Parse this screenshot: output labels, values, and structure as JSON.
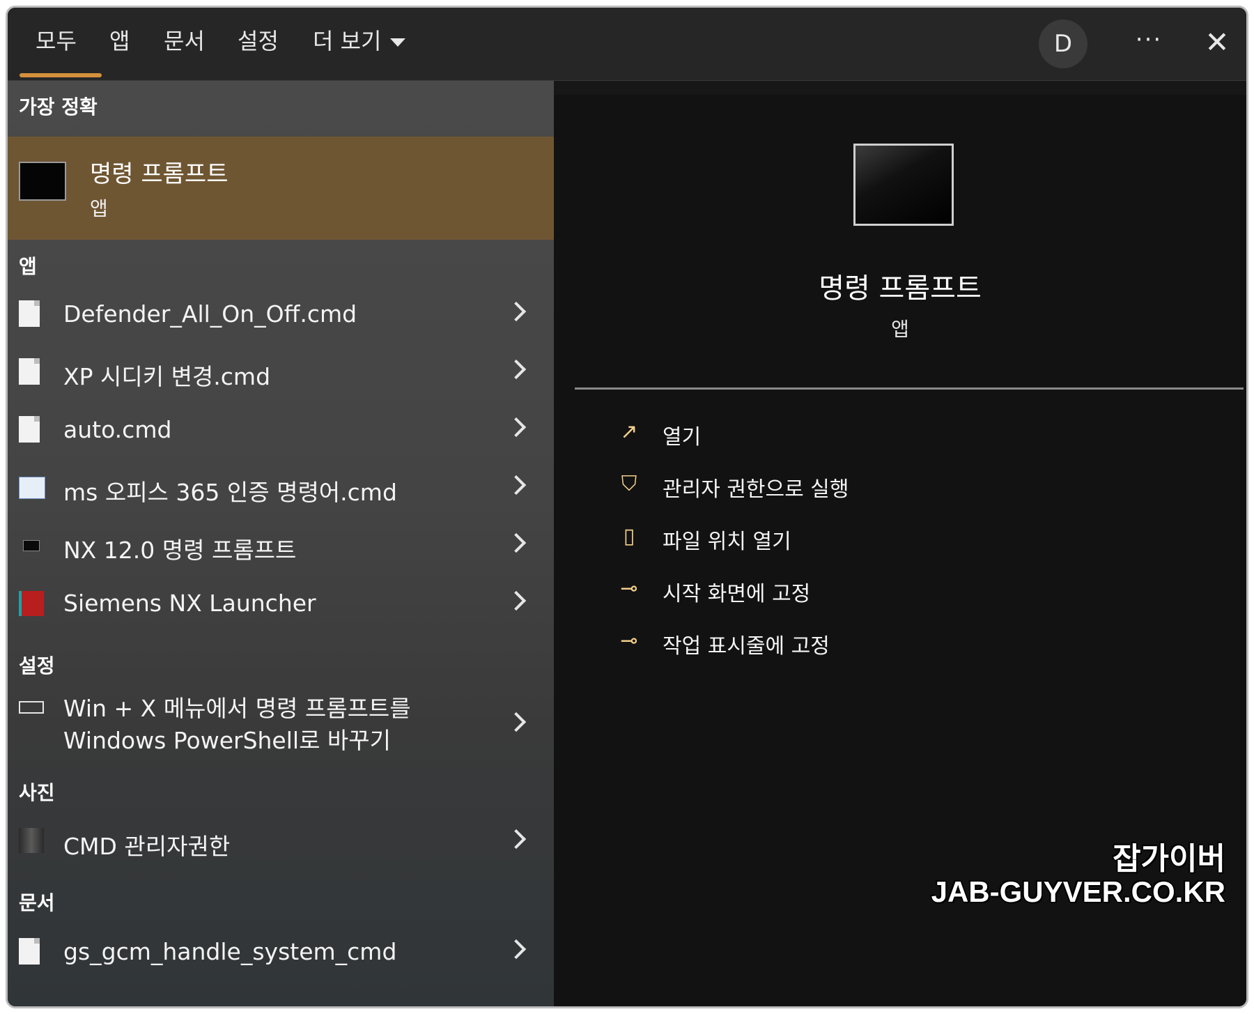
{
  "tabs": [
    {
      "label": "모두"
    },
    {
      "label": "앱"
    },
    {
      "label": "문서"
    },
    {
      "label": "설정"
    },
    {
      "label": "더 보기"
    }
  ],
  "header": {
    "avatar_letter": "D",
    "more_label": "···",
    "close_label": "✕"
  },
  "accent_color": "#d4903a",
  "best_match": {
    "section_label": "가장 정확",
    "title": "명령 프롬프트",
    "subtitle": "앱"
  },
  "sections": {
    "apps_label": "앱",
    "settings_label": "설정",
    "photos_label": "사진",
    "docs_label": "문서"
  },
  "apps": [
    {
      "label": "Defender_All_On_Off.cmd"
    },
    {
      "label": "XP 시디키 변경.cmd"
    },
    {
      "label": "auto.cmd"
    },
    {
      "label": "ms 오피스 365 인증 명령어.cmd"
    },
    {
      "label": "NX 12.0 명령 프롬프트"
    },
    {
      "label": "Siemens NX Launcher"
    }
  ],
  "settings": [
    {
      "label": "Win + X 메뉴에서 명령 프롬프트를 Windows PowerShell로 바꾸기"
    }
  ],
  "photos": [
    {
      "label": "CMD 관리자권한"
    }
  ],
  "docs": [
    {
      "label": "gs_gcm_handle_system_cmd"
    }
  ],
  "preview": {
    "title": "명령 프롬프트",
    "subtitle": "앱"
  },
  "actions": [
    {
      "label": "열기",
      "icon": "open-icon"
    },
    {
      "label": "관리자 권한으로 실행",
      "icon": "admin-shield-icon"
    },
    {
      "label": "파일 위치 열기",
      "icon": "folder-icon"
    },
    {
      "label": "시작 화면에 고정",
      "icon": "pin-icon"
    },
    {
      "label": "작업 표시줄에 고정",
      "icon": "pin-icon"
    }
  ],
  "watermark": {
    "line1": "잡가이버",
    "line2": "JAB-GUYVER.CO.KR"
  }
}
